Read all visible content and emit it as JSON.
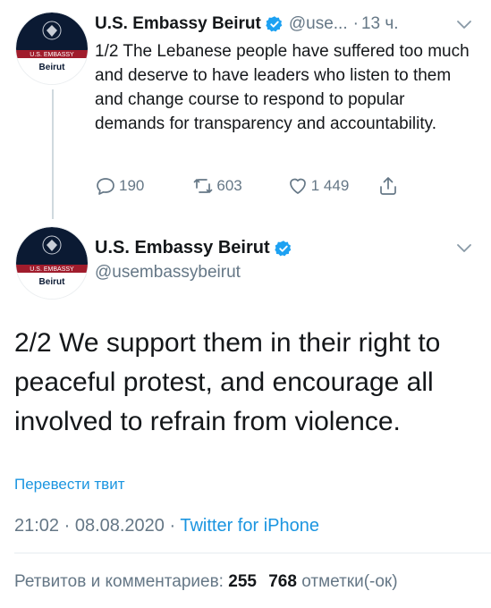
{
  "tweet1": {
    "display_name": "U.S. Embassy Beirut",
    "handle": "@use...",
    "separator": "·",
    "time": "13 ч.",
    "text": "1/2 The Lebanese people have suffered too much and deserve to have leaders who listen to them and change course to respond to popular demands for transparency and accountability.",
    "replies": "190",
    "retweets": "603",
    "likes": "1 449",
    "avatar": {
      "top_text": "U.S. EMBASSY",
      "bottom_text": "Beirut"
    }
  },
  "tweet2": {
    "display_name": "U.S. Embassy Beirut",
    "handle": "@usembassybeirut",
    "text": "2/2 We support them in their right to peaceful protest, and encourage all involved to refrain from violence.",
    "translate": "Перевести твит",
    "timestamp": "21:02 · 08.08.2020 ·",
    "source": "Twitter for iPhone",
    "stats_label": "Ретвитов и комментариев:",
    "retweet_count": "255",
    "like_count": "768",
    "likes_label": "отметки(-ок)",
    "avatar": {
      "top_text": "U.S. EMBASSY",
      "bottom_text": "Beirut"
    }
  },
  "colors": {
    "accent": "#1b95e0",
    "verified": "#1da1f2",
    "muted": "#657786",
    "avatar_band": "#a01c2c",
    "avatar_navy": "#0b1a33"
  }
}
